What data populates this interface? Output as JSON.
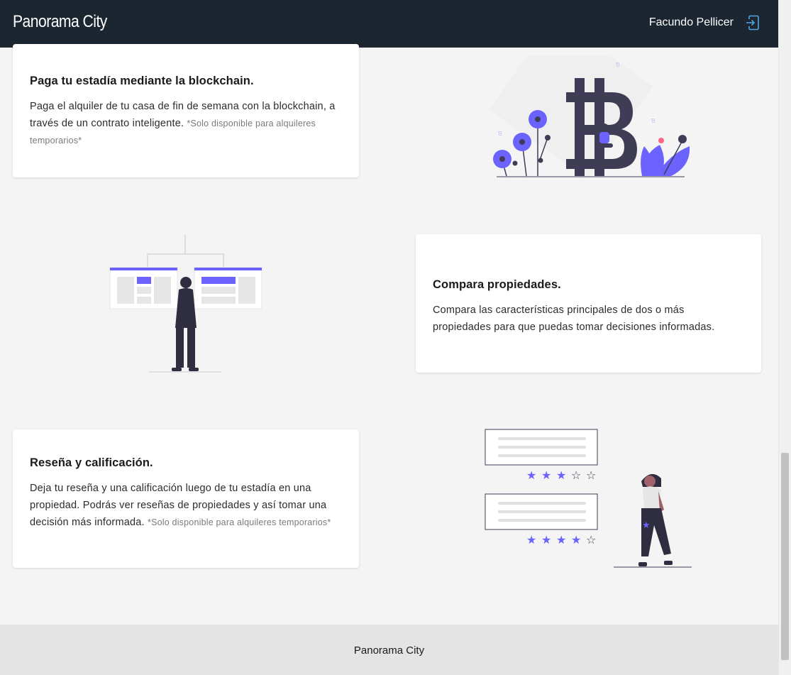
{
  "navbar": {
    "brand": "Panorama City",
    "user_name": "Facundo Pellicer",
    "logout_icon": "logout-icon"
  },
  "features": [
    {
      "title": "Paga tu estadía mediante la blockchain.",
      "text": "Paga el alquiler de tu casa de fin de semana con la blockchain, a través de un contrato inteligente.",
      "note": "*Solo disponible para alquileres temporarios*",
      "illustration": "bitcoin-illustration"
    },
    {
      "title": "Compara propiedades.",
      "text": "Compara las características principales de dos o más propiedades para que puedas tomar decisiones informadas.",
      "note": "",
      "illustration": "compare-illustration"
    },
    {
      "title": "Reseña y calificación.",
      "text": "Deja tu reseña y una calificación luego de tu estadía en una propiedad. Podrás ver reseñas de propiedades y así tomar una decisión más informada.",
      "note": "*Solo disponible para alquileres temporarios*",
      "illustration": "review-illustration"
    }
  ],
  "footer": {
    "text": "Panorama City"
  },
  "colors": {
    "navbar": "#1b2631",
    "accent": "#6c63ff",
    "dark": "#3f3d56"
  }
}
